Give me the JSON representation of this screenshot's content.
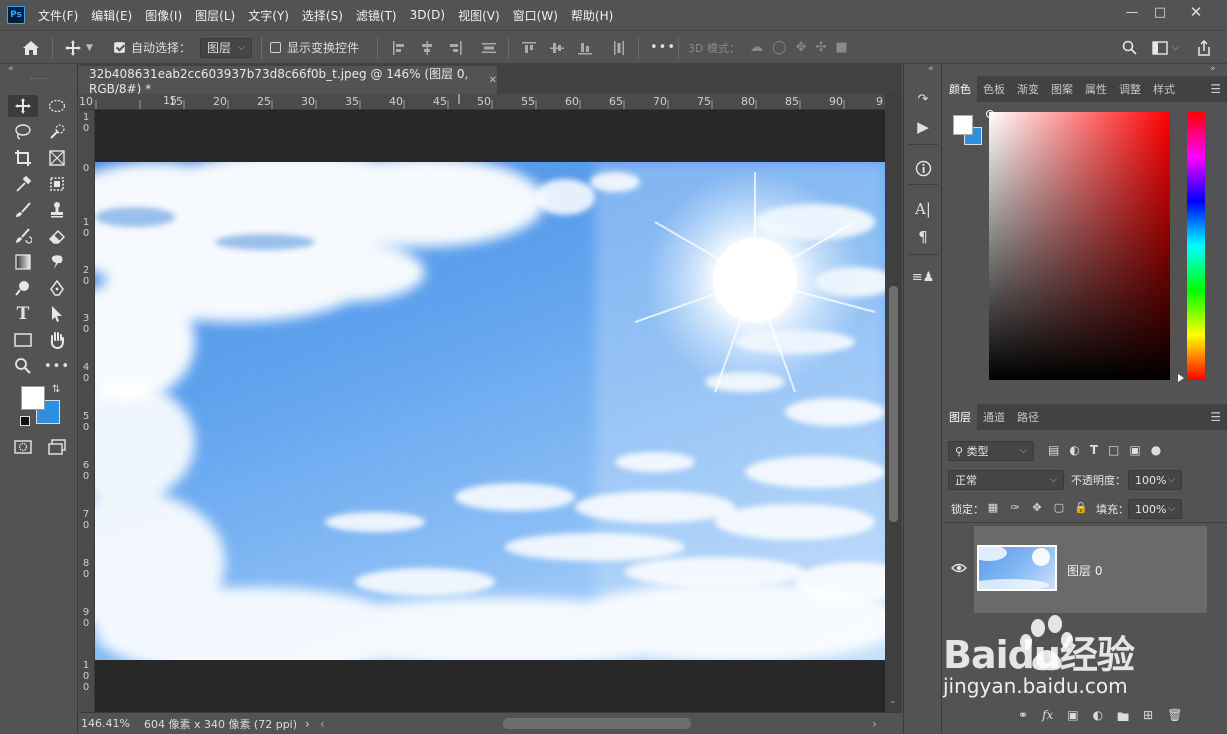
{
  "app": {
    "logo": "Ps"
  },
  "menu": [
    "文件(F)",
    "编辑(E)",
    "图像(I)",
    "图层(L)",
    "文字(Y)",
    "选择(S)",
    "滤镜(T)",
    "3D(D)",
    "视图(V)",
    "窗口(W)",
    "帮助(H)"
  ],
  "options": {
    "auto_select_label": "自动选择：",
    "auto_select_checked": true,
    "auto_select_target": "图层",
    "show_transform_label": "显示变换控件",
    "more": "•••",
    "mode_3d_label": "3D 模式："
  },
  "document": {
    "tab_title": "32b408631eab2cc603937b73d8c66f0b_t.jpeg @ 146% (图层 0, RGB/8#) *",
    "ruler_top": [
      "10",
      "15",
      "20",
      "25",
      "30",
      "35",
      "40",
      "45",
      "50",
      "55",
      "60",
      "65",
      "70",
      "75",
      "80",
      "85",
      "90",
      "9"
    ],
    "ruler_left": [
      [
        "1",
        "0"
      ],
      [
        "0"
      ],
      [
        "1",
        "0"
      ],
      [
        "2",
        "0"
      ],
      [
        "3",
        "0"
      ],
      [
        "4",
        "0"
      ],
      [
        "5",
        "0"
      ],
      [
        "6",
        "0"
      ],
      [
        "7",
        "0"
      ],
      [
        "8",
        "0"
      ],
      [
        "9",
        "0"
      ],
      [
        "1",
        "0",
        "0"
      ]
    ]
  },
  "status": {
    "zoom": "146.41%",
    "info": "604 像素 x 340 像素 (72 ppi)"
  },
  "color_panel": {
    "tabs": [
      "颜色",
      "色板",
      "渐变",
      "图案",
      "属性",
      "调整",
      "样式"
    ],
    "foreground": "#ffffff",
    "background": "#2d8fe0"
  },
  "layers_panel": {
    "tabs": [
      "图层",
      "通道",
      "路径"
    ],
    "filter_kind": "类型",
    "blend_mode": "正常",
    "opacity_label": "不透明度：",
    "opacity": "100%",
    "lock_label": "锁定：",
    "fill_label": "填充：",
    "fill": "100%",
    "layers": [
      {
        "name": "图层 0",
        "visible": true
      }
    ]
  },
  "watermark": {
    "brand": "Baidu经验",
    "url": "jingyan.baidu.com"
  },
  "colors": {
    "accent": "#31a8ff",
    "chrome": "#535353",
    "canvas_sky": "#5fa2ee"
  }
}
